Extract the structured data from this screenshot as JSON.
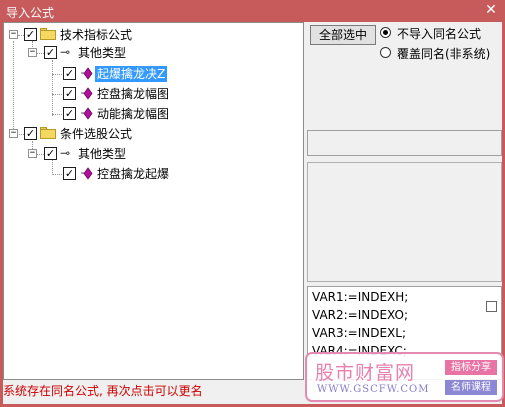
{
  "window": {
    "title": "导入公式",
    "close_glyph": "✕"
  },
  "tree": {
    "nodes": [
      {
        "id": "tech",
        "label": "技术指标公式",
        "expander": "−",
        "checked": "✓"
      },
      {
        "id": "tech-other",
        "label": "其他类型",
        "expander": "−",
        "checked": "✓"
      },
      {
        "id": "f1",
        "label": "起爆擒龙决Z",
        "checked": "✓",
        "selected": true
      },
      {
        "id": "f2",
        "label": "控盘擒龙幅图",
        "checked": "✓"
      },
      {
        "id": "f3",
        "label": "动能擒龙幅图",
        "checked": "✓"
      },
      {
        "id": "cond",
        "label": "条件选股公式",
        "expander": "−",
        "checked": "✓"
      },
      {
        "id": "cond-other",
        "label": "其他类型",
        "expander": "−",
        "checked": "✓"
      },
      {
        "id": "f4",
        "label": "控盘擒龙起爆",
        "checked": "✓"
      }
    ]
  },
  "controls": {
    "select_all_label": "全部选中",
    "radio_skip_label": "不导入同名公式",
    "radio_overwrite_label": "覆盖同名(非系统)"
  },
  "code": {
    "lines": [
      "VAR1:=INDEXH;",
      "VAR2:=INDEXO;",
      "VAR3:=INDEXL;",
      "VAR4:=INDEXC;"
    ]
  },
  "status": {
    "message": "系统存在同名公式, 再次点击可以更名"
  },
  "watermark": {
    "site_name": "股市财富网",
    "url": "WWW.GSCFW.COM",
    "tag1": "指标分享",
    "tag2": "名师课程"
  },
  "colors": {
    "titlebar": "#c75a5a",
    "selection": "#3399ff",
    "status_text": "#cc0000",
    "icon_diamond": "#b0109a"
  }
}
